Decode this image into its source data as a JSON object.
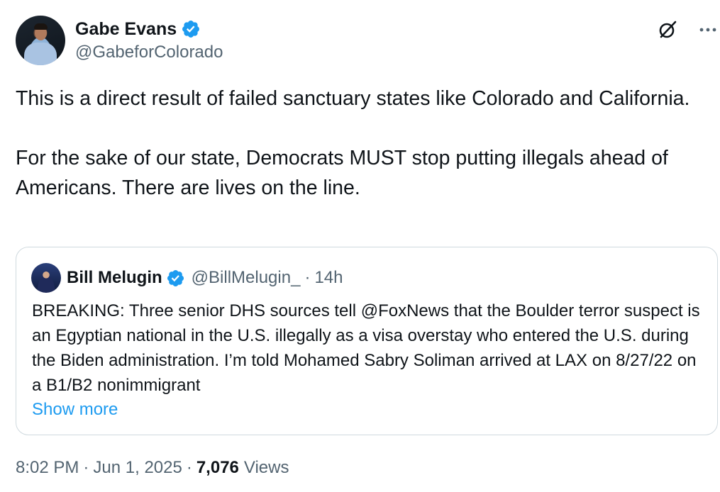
{
  "author": {
    "display_name": "Gabe Evans",
    "handle": "@GabeforColorado",
    "verified": true
  },
  "icons": {
    "verified_badge": "verified-badge-icon",
    "grok": "grok-icon",
    "more": "more-options-icon"
  },
  "tweet": {
    "paragraphs": [
      "This is a direct result of failed sanctuary states like Colorado and California.",
      "For the sake of our state, Democrats MUST stop putting illegals ahead of Americans. There are lives on the line."
    ]
  },
  "quote": {
    "display_name": "Bill Melugin",
    "handle": "@BillMelugin_",
    "separator": "·",
    "time": "14h",
    "text": "BREAKING: Three senior DHS sources tell @FoxNews that the Boulder terror suspect is an Egyptian national in the U.S. illegally as a visa overstay who entered the U.S. during the Biden administration. I’m told Mohamed Sabry Soliman arrived at LAX on 8/27/22 on a B1/B2 nonimmigrant",
    "show_more": "Show more"
  },
  "meta": {
    "time": "8:02 PM",
    "separator": "·",
    "date": "Jun 1, 2025",
    "views_count": "7,076",
    "views_label": "Views"
  },
  "colors": {
    "text": "#0f1419",
    "secondary": "#536471",
    "accent": "#1d9bf0",
    "border": "#cfd9de"
  }
}
